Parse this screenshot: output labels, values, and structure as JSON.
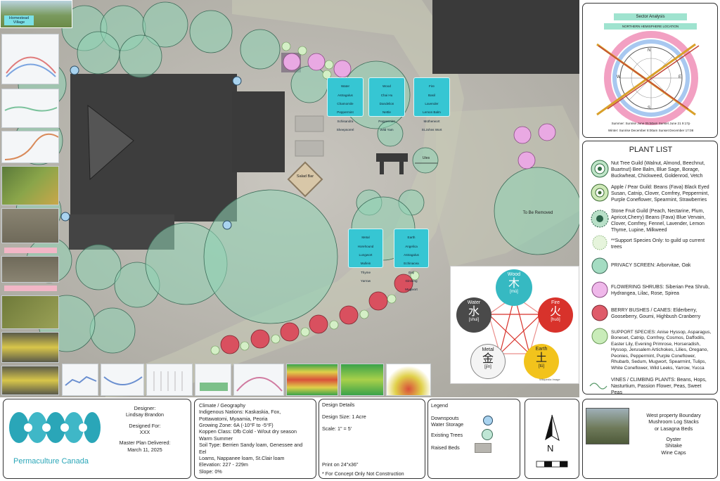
{
  "map": {
    "inset_label": "Homestead Village",
    "salad_bar": "Salad Bar",
    "utes": "Utes",
    "to_be_removed": "To Be Removed",
    "element_boxes": [
      {
        "name": "Water",
        "plants": [
          "Astragalus",
          "Chamomile",
          "Peppermint",
          "Schisandra",
          "Sheepsorrel"
        ]
      },
      {
        "name": "Wood",
        "plants": [
          "Chai Hu",
          "Dandelion",
          "Nettle",
          "Peppermint",
          "Wild Yam"
        ]
      },
      {
        "name": "Fire",
        "plants": [
          "Basil",
          "Lavender",
          "Lemon Balm",
          "Motherwort",
          "St.Johns Wort"
        ]
      },
      {
        "name": "Metal",
        "plants": [
          "Horehound",
          "Lungwort",
          "Mullein",
          "Thyme",
          "Yarrow"
        ]
      },
      {
        "name": "Earth",
        "plants": [
          "Angelica",
          "Astragalus",
          "Echinacea",
          "Goji",
          "Ginseng",
          "Mugwort"
        ]
      }
    ],
    "five_elements": [
      {
        "name": "Wood",
        "glyph": "木",
        "pinyin": "[mù]",
        "color": "#36b9c2"
      },
      {
        "name": "Fire",
        "glyph": "火",
        "pinyin": "[huǒ]",
        "color": "#d8322b"
      },
      {
        "name": "Earth",
        "glyph": "土",
        "pinyin": "[tǔ]",
        "color": "#f2c31c"
      },
      {
        "name": "Metal",
        "glyph": "金",
        "pinyin": "[jīn]",
        "color": "#f4f4f4"
      },
      {
        "name": "Water",
        "glyph": "水",
        "pinyin": "[shuǐ]",
        "color": "#4a4a4a"
      }
    ],
    "wuxing_credit": "Wikipedia Image"
  },
  "sector": {
    "title": "Sector Analysis",
    "subtitle": "NORTHERN HEMISPHERE LOCATION",
    "compass": [
      "N",
      "E",
      "S",
      "W"
    ],
    "summer": "Summer: Sunrise June 05:50am Sunset June 21 9:17p",
    "winter": "Winter: Sunrise December 8:00am Sunset December 17:08"
  },
  "plant_list": {
    "title": "PLANT LIST",
    "items": [
      {
        "icon": "nut-tree-guild-icon",
        "text": "Nut Tree Guild (Walnut, Almond, Beechnut, Buartnut) Bee Balm, Blue Sage, Borage, Buckwheat, Chickweed, Goldenrod, Vetch"
      },
      {
        "icon": "apple-pear-guild-icon",
        "text": "Apple / Pear Guild: Beans (Fava) Black Eyed Susan, Catnip, Clover, Comfrey, Peppermint, Purple Coneflower, Spearmint, Strawberries"
      },
      {
        "icon": "stone-fruit-guild-icon",
        "text": "Stone Fruit Guild (Peach, Nectarine, Plum, Apricot,Cherry) Beans (Fava) Blue Vervain, Clover, Comfrey, Fennel, Lavender, Lemon Thyme, Lupine, Milkweed"
      },
      {
        "icon": "support-species-tree-icon",
        "text": "**Support Species Only: to guild up current trees"
      },
      {
        "icon": "privacy-screen-icon",
        "text": "PRIVACY SCREEN: Arborvitae, Oak"
      },
      {
        "icon": "flowering-shrub-icon",
        "text": "FLOWERING SHRUBS: Siberian Pea Shrub, Hydrangea, Lilac, Rose, Spirea"
      },
      {
        "icon": "berry-bush-icon",
        "text": "BERRY BUSHES / CANES: Elderberry, Gooseberry, Goumi, Highbush Cranberry"
      },
      {
        "icon": "support-species-icon",
        "text": "SUPPORT SPECIES: Anise Hyssop, Asparagus, Boneset, Catnip, Comfrey, Cosmos, Daffodils, Easter Lily, Evening Primrose, Horseradish, Hyssop, Jerusalem Artichokes, Lilies, Oregano, Peonies, Peppermint, Purple Coneflower, Rhubarb, Sedum, Mugwort, Spearmint, Tulips, White Coneflower, Wild Leeks, Yarrow, Yucca"
      },
      {
        "icon": "vine-icon",
        "text": "VINES / CLIMBING PLANTS: Beans, Hops, Nasturtium, Passion Flower, Peas, Sweet Peas"
      }
    ]
  },
  "brand": {
    "name": "Permaculture Canada"
  },
  "designer": {
    "designer_label": "Designer:",
    "designer": "Lindsay Brandon",
    "for_label": "Designed For:",
    "for": "XXX",
    "delivered_label": "Master Plan Delivered:",
    "delivered": "March 11, 2025"
  },
  "climate": {
    "lines": [
      "Climate / Geography",
      "Indigenous Nations: Kaskaskia, Fox,",
      "Pottawatomi, Myaamia, Peoria",
      "Growing Zone: 6A (-10°F to -5°F)",
      "Koppen Class: Dfb Cold - W/out dry season",
      "Warm Summer",
      "Soil Type: Berrien Sandy loam, Genessee and",
      "Eel",
      "Loams, Nappanee loam, St.Clair loam",
      "Elevation: 227 - 229m",
      "Slope: 0%"
    ]
  },
  "design_details": {
    "title": "Design Details",
    "size": "Design Size: 1 Acre",
    "scale": "Scale: 1\" = 5'",
    "print": "Print on 24\"x36\"",
    "note": "* For Concept Only Not Construction"
  },
  "legend": {
    "title": "Legend",
    "items": [
      {
        "label": "Downspouts\nWater Storage"
      },
      {
        "label": "Existing Trees"
      },
      {
        "label": "Raised Beds"
      }
    ]
  },
  "north": {
    "label": "N"
  },
  "boundary": {
    "lines": [
      "West property Boundary",
      "Mushroom Log Stacks",
      "or Lasagna Beds",
      "",
      "Oyster",
      "Shitake",
      "Wine Caps"
    ]
  },
  "colors": {
    "teal_box": "#36c6d3",
    "existing_tree": "#8fd3b5",
    "flowering_shrub": "#e9a9e3",
    "berry_bush": "#d9505f",
    "support_species": "#b8e3a9",
    "roof": "#3f3f3f",
    "brand": "#2aa6b8"
  }
}
